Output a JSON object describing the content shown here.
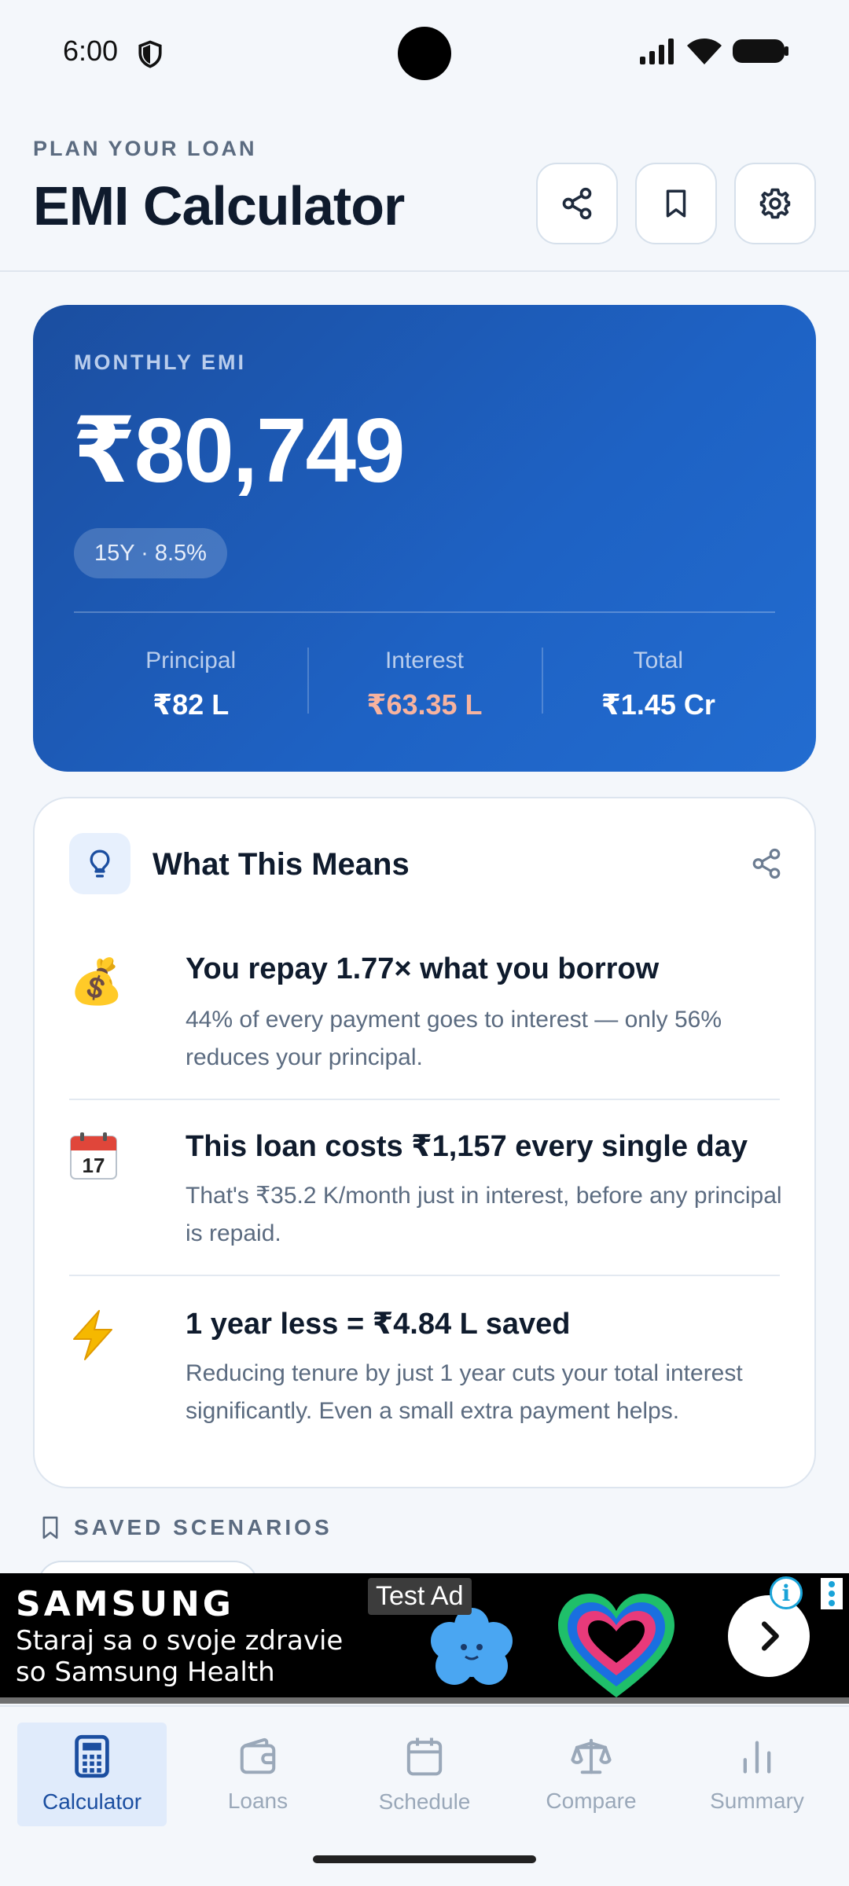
{
  "status_bar": {
    "time": "6:00"
  },
  "header": {
    "eyebrow": "PLAN YOUR LOAN",
    "title": "EMI Calculator",
    "actions": [
      "share-icon",
      "bookmark-icon",
      "gear-icon"
    ]
  },
  "emi": {
    "label": "MONTHLY EMI",
    "amount": "₹80,749",
    "chip": "15Y · 8.5%",
    "stats": [
      {
        "label": "Principal",
        "value": "₹82 L"
      },
      {
        "label": "Interest",
        "value": "₹63.35 L"
      },
      {
        "label": "Total",
        "value": "₹1.45 Cr"
      }
    ],
    "colors": {
      "card_start": "#1b4ea0",
      "card_end": "#226cd0",
      "interest_value": "#f7b39f"
    }
  },
  "insights": {
    "title": "What This Means",
    "items": [
      {
        "icon": "money-bag-icon",
        "emoji": "💰",
        "heading": "You repay 1.77× what you borrow",
        "body": "44% of every payment goes to interest — only 56% reduces your principal."
      },
      {
        "icon": "calendar-icon",
        "emoji": "📅",
        "heading": "This loan costs ₹1,157 every single day",
        "body": "That's ₹35.2 K/month just in interest, before any principal is repaid."
      },
      {
        "icon": "lightning-icon",
        "emoji": "⚡",
        "heading": "1 year less = ₹4.84 L saved",
        "body": "Reducing tenure by just 1 year cuts your total interest significantly. Even a small extra payment helps."
      }
    ]
  },
  "saved": {
    "label": "SAVED SCENARIOS"
  },
  "ad": {
    "badge": "Test Ad",
    "brand": "SAMSUNG",
    "line1": "Staraj sa o svoje zdravie",
    "line2": "so Samsung Health"
  },
  "nav": {
    "items": [
      {
        "label": "Calculator",
        "icon": "calculator-icon",
        "active": true
      },
      {
        "label": "Loans",
        "icon": "wallet-icon",
        "active": false
      },
      {
        "label": "Schedule",
        "icon": "calendar-icon",
        "active": false
      },
      {
        "label": "Compare",
        "icon": "scale-icon",
        "active": false
      },
      {
        "label": "Summary",
        "icon": "bar-chart-icon",
        "active": false
      }
    ]
  }
}
